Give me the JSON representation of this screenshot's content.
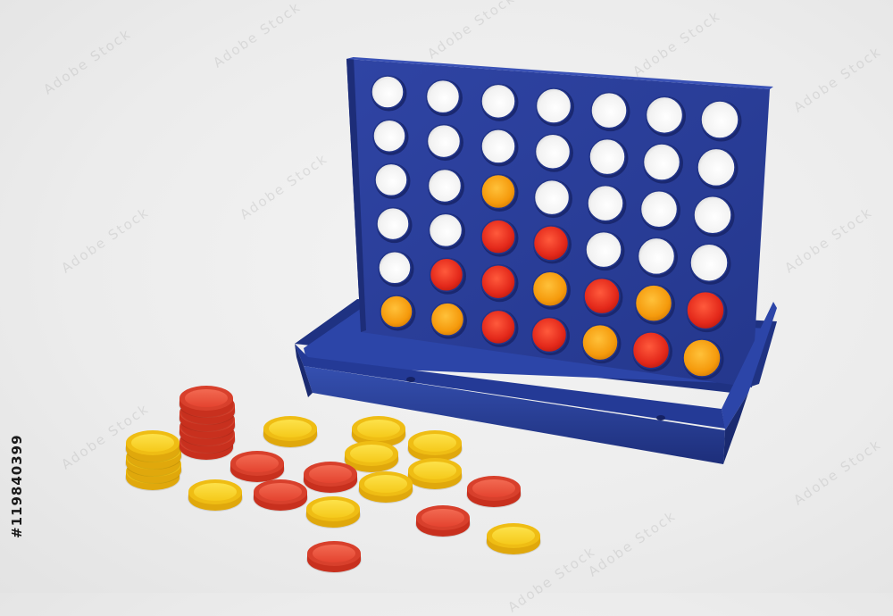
{
  "photo": {
    "stock_id_text": "#119840399",
    "watermark_text": "Adobe Stock",
    "subject": "four-in-a-row-game",
    "colors": {
      "background": "#ececec",
      "board_blue": "#2b3f9a",
      "board_blue_dark": "#1d2d78",
      "disc_red": "#e8301e",
      "disc_orange": "#f7a10f",
      "disc_yellow": "#f6d21a"
    },
    "board": {
      "columns": 7,
      "rows": 6,
      "grid": [
        [
          "empty",
          "empty",
          "empty",
          "empty",
          "empty",
          "empty",
          "empty"
        ],
        [
          "empty",
          "empty",
          "empty",
          "empty",
          "empty",
          "empty",
          "empty"
        ],
        [
          "empty",
          "empty",
          "orange",
          "empty",
          "empty",
          "empty",
          "empty"
        ],
        [
          "empty",
          "empty",
          "red",
          "red",
          "empty",
          "empty",
          "empty"
        ],
        [
          "empty",
          "red",
          "red",
          "orange",
          "red",
          "orange",
          "red"
        ],
        [
          "orange",
          "orange",
          "red",
          "red",
          "orange",
          "red",
          "orange"
        ]
      ]
    },
    "loose_tokens": {
      "red_stack_count": 7,
      "yellow_stack_count": 5,
      "loose_red": 7,
      "loose_yellow": 10
    }
  }
}
